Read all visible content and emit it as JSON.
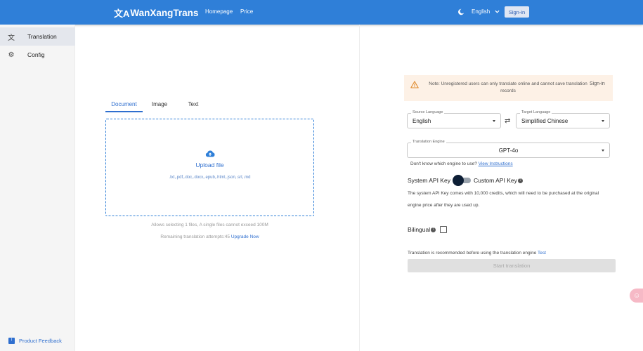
{
  "header": {
    "brand_mark": "文A",
    "brand": "WanXangTrans",
    "nav": [
      "Homepage",
      "Price"
    ],
    "language": "English",
    "signin": "Sign-in",
    "bg_color": "#2f7fd8"
  },
  "sidebar": {
    "items": [
      {
        "icon": "translate-icon",
        "label": "Translation",
        "active": true
      },
      {
        "icon": "gear-icon",
        "label": "Config",
        "active": false
      }
    ],
    "feedback": "Product Feedback"
  },
  "tabs": [
    "Document",
    "Image",
    "Text"
  ],
  "upload": {
    "title": "Upload file",
    "extensions": ".txt,.pdf,.doc,.docx,.epub,.html,.json,.srt,.md",
    "hint_limit": "Allows selecting 1 files, A single files cannot exceed 100M",
    "hint_remaining": "Remaining translation attempts:45",
    "upgrade": "Upgrade Now"
  },
  "notice": {
    "message": "Note: Unregistered users can only translate online and cannot save translation records",
    "signin": "Sign-in"
  },
  "source_language": {
    "label": "Source Language",
    "value": "English"
  },
  "target_language": {
    "label": "Target Language",
    "value": "Simplified Chinese"
  },
  "engine": {
    "label": "Translation Engine",
    "value": "GPT-4o",
    "help_text": "Don't know which engine to use?",
    "help_link": "View Instructions"
  },
  "api": {
    "system": "System API Key",
    "custom": "Custom API Key",
    "description": "The system API Key comes with 10,000 credits, which will need to be purchased at the original engine price after they are used up."
  },
  "bilingual": {
    "label": "Bilingual",
    "checked": false
  },
  "recommend": {
    "text": "Translation is recommended before using the translation engine",
    "link": "Test"
  },
  "start_button": "Start translation"
}
